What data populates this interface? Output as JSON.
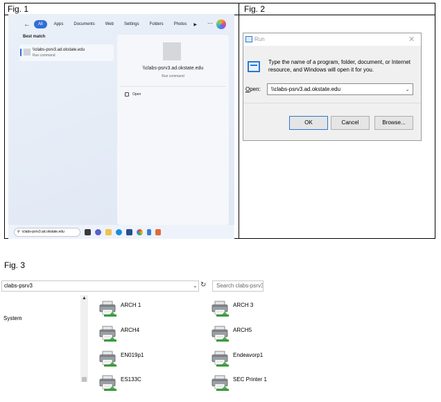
{
  "figures": {
    "fig1_label": "Fig. 1",
    "fig2_label": "Fig. 2",
    "fig3_label": "Fig.  3"
  },
  "search_window": {
    "tabs": [
      "All",
      "Apps",
      "Documents",
      "Web",
      "Settings",
      "Folders",
      "Photos"
    ],
    "active_tab": "All",
    "best_match_heading": "Best match",
    "result_title": "\\\\clabs-psrv3.ad.okstate.edu",
    "result_subtitle": "Run command",
    "preview_title": "\\\\clabs-psrv3.ad.okstate.edu",
    "preview_subtitle": "Run command",
    "open_action": "Open",
    "taskbar_search_value": "\\clabs-psrv3.ad.okstate.edu"
  },
  "run_dialog": {
    "title": "Run",
    "description": "Type the name of a program, folder, document, or Internet resource, and Windows will open it for you.",
    "open_label": "Open:",
    "open_value": "\\\\clabs-psrv3.ad.okstate.edu",
    "ok_label": "OK",
    "cancel_label": "Cancel",
    "browse_label": "Browse..."
  },
  "explorer": {
    "address": "clabs-psrv3",
    "search_placeholder": "Search clabs-psrv3",
    "nav_items": [
      "System"
    ],
    "printers_left": [
      "ARCH 1",
      "ARCH4",
      "EN019p1",
      "ES133C"
    ],
    "printers_right": [
      "ARCH 3",
      "ARCH5",
      "Endeavorp1",
      "SEC Printer 1"
    ]
  }
}
